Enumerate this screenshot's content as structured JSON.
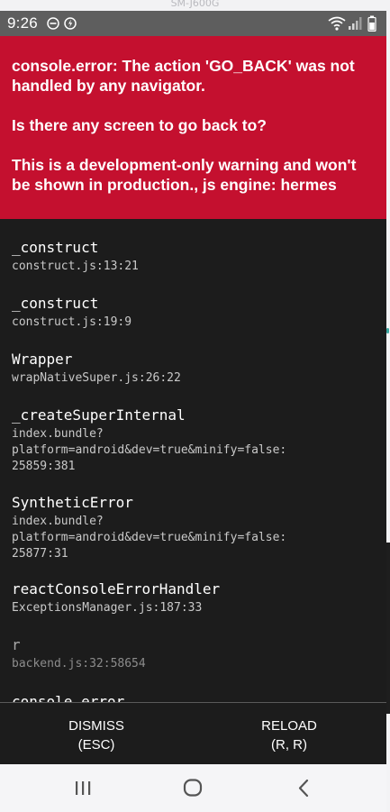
{
  "caption": "SM-J600G",
  "status_bar": {
    "time": "9:26",
    "icons": [
      "dnd-icon",
      "data-saver-icon",
      "wifi-icon",
      "signal-icon",
      "battery-icon"
    ]
  },
  "error_banner": {
    "line1": "console.error: The action 'GO_BACK' was not handled by any navigator.",
    "line2": "Is there any screen to go back to?",
    "line3": "This is a development-only warning and won't be shown in production., js engine: hermes"
  },
  "stack": [
    {
      "name": "_construct",
      "location": [
        "construct.js:13:21"
      ]
    },
    {
      "name": "_construct",
      "location": [
        "construct.js:19:9"
      ]
    },
    {
      "name": "Wrapper",
      "location": [
        "wrapNativeSuper.js:26:22"
      ]
    },
    {
      "name": "_createSuperInternal",
      "location": [
        "index.bundle?",
        "platform=android&dev=true&minify=false:",
        "25859:381"
      ]
    },
    {
      "name": "SyntheticError",
      "location": [
        "index.bundle?",
        "platform=android&dev=true&minify=false:",
        "25877:31"
      ]
    },
    {
      "name": "reactConsoleErrorHandler",
      "location": [
        "ExceptionsManager.js:187:33"
      ]
    },
    {
      "name": "r",
      "location": [
        "backend.js:32:58654"
      ]
    },
    {
      "name": "console.error",
      "location": []
    }
  ],
  "actions": {
    "dismiss_line1": "DISMISS",
    "dismiss_line2": "(ESC)",
    "reload_line1": "RELOAD",
    "reload_line2": "(R, R)"
  },
  "nav": [
    "recents-icon",
    "home-icon",
    "back-icon"
  ],
  "colors": {
    "banner": "#c4102f",
    "background": "#1c1c1c",
    "status_bar": "#5e5e5e",
    "nav_bar": "#f5f5f7"
  }
}
